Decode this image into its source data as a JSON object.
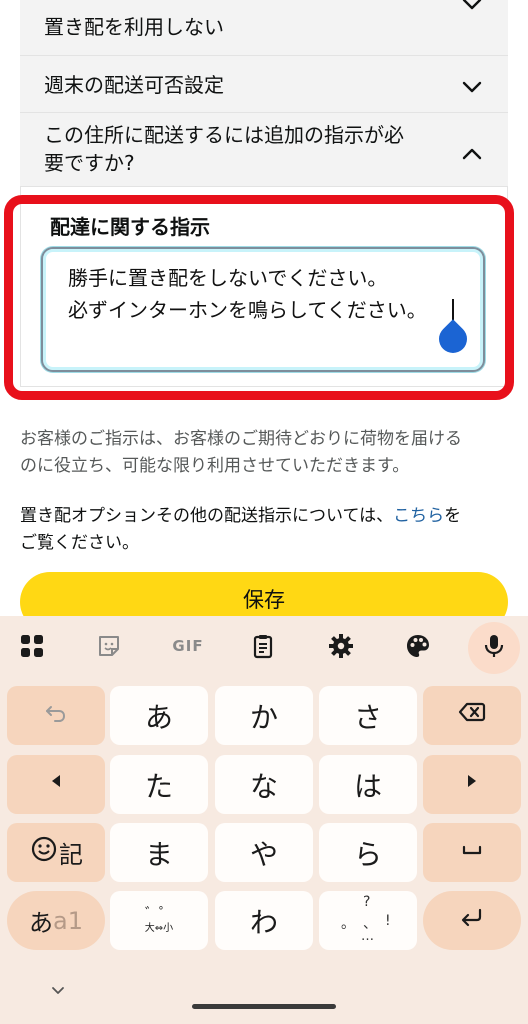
{
  "accordion": {
    "items": [
      {
        "label": "置き配を利用しない",
        "state": "collapsed"
      },
      {
        "label": "週末の配送可否設定",
        "state": "collapsed"
      },
      {
        "label_line1": "この住所に配送するには追加の指示が必",
        "label_line2": "要ですか?",
        "state": "expanded"
      }
    ],
    "instructions_label": "配達に関する指示",
    "instructions_value_line1": "勝手に置き配をしないでください。",
    "instructions_value_line2": "必ずインターホンを鳴らしてください。"
  },
  "help": {
    "line1": "お客様のご指示は、お客様のご期待どおりに荷物を届ける",
    "line2": "のに役立ち、可能な限り利用させていただきます。",
    "other_prefix": "置き配オプションその他の配送指示については、",
    "other_link": "こちら",
    "other_suffix1": "を",
    "other_suffix2": "ご覧ください。"
  },
  "save_button": {
    "label": "保存"
  },
  "colors": {
    "accent": "#ffd814",
    "annotation": "#e8101b",
    "link": "#2162a1",
    "keyboard_bg": "#f7eae1"
  },
  "keyboard": {
    "toolbar": {
      "gif": "GIF",
      "icons": [
        "apps-grid-icon",
        "sticker-icon",
        "gif-icon",
        "clipboard-icon",
        "settings-gear-icon",
        "palette-icon",
        "microphone-icon"
      ]
    },
    "row1": [
      "あ",
      "か",
      "さ"
    ],
    "row2": [
      "た",
      "な",
      "は"
    ],
    "row3": [
      "ま",
      "や",
      "ら"
    ],
    "row4": [
      "わ"
    ],
    "emoji_key": "記",
    "mode_key_kana": "あ",
    "mode_key_alpha": "a1",
    "dakuten_key": {
      "top": "゛゜",
      "bottom": "大⇔小"
    },
    "punct_key": {
      "top": "?",
      "left": "。",
      "mid": "、",
      "right": "!",
      "bottom": "…"
    }
  }
}
